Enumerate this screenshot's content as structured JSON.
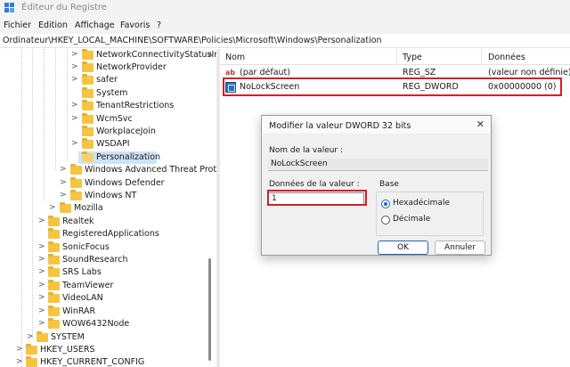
{
  "window": {
    "title": "Éditeur du Registre"
  },
  "menu": [
    "Fichier",
    "Edition",
    "Affichage",
    "Favoris",
    "?"
  ],
  "address": "Ordinateur\\HKEY_LOCAL_MACHINE\\SOFTWARE\\Policies\\Microsoft\\Windows\\Personalization",
  "tree": [
    {
      "label": "NetworkConnectivityStatusIr",
      "chev": ">"
    },
    {
      "label": "NetworkProvider",
      "chev": ">"
    },
    {
      "label": "safer",
      "chev": ">"
    },
    {
      "label": "System",
      "chev": ""
    },
    {
      "label": "TenantRestrictions",
      "chev": ">"
    },
    {
      "label": "WcmSvc",
      "chev": ">"
    },
    {
      "label": "WorkplaceJoin",
      "chev": ""
    },
    {
      "label": "WSDAPI",
      "chev": ">"
    },
    {
      "label": "Personalization",
      "chev": ""
    },
    {
      "label": "Windows Advanced Threat Prote",
      "chev": ">"
    },
    {
      "label": "Windows Defender",
      "chev": ">"
    },
    {
      "label": "Windows NT",
      "chev": ">"
    },
    {
      "label": "Mozilla",
      "chev": ">"
    },
    {
      "label": "Realtek",
      "chev": ">"
    },
    {
      "label": "RegisteredApplications",
      "chev": ""
    },
    {
      "label": "SonicFocus",
      "chev": ">"
    },
    {
      "label": "SoundResearch",
      "chev": ">"
    },
    {
      "label": "SRS Labs",
      "chev": ">"
    },
    {
      "label": "TeamViewer",
      "chev": ">"
    },
    {
      "label": "VideoLAN",
      "chev": ">"
    },
    {
      "label": "WinRAR",
      "chev": ">"
    },
    {
      "label": "WOW6432Node",
      "chev": ">"
    },
    {
      "label": "SYSTEM",
      "chev": ">"
    },
    {
      "label": "HKEY_USERS",
      "chev": ">"
    },
    {
      "label": "HKEY_CURRENT_CONFIG",
      "chev": ">"
    }
  ],
  "list": {
    "columns": {
      "name": "Nom",
      "type": "Type",
      "data": "Données"
    },
    "rows": [
      {
        "name": "(par défaut)",
        "type": "REG_SZ",
        "data": "(valeur non définie)",
        "icon": "string-value-icon"
      },
      {
        "name": "NoLockScreen",
        "type": "REG_DWORD",
        "data": "0x00000000 (0)",
        "icon": "dword-value-icon"
      }
    ]
  },
  "dialog": {
    "title": "Modifier la valeur DWORD 32 bits",
    "close": "✕",
    "name_label": "Nom de la valeur :",
    "name_value": "NoLockScreen",
    "data_label": "Données de la valeur :",
    "data_value": "1",
    "base_label": "Base",
    "radio_hex": "Hexadécimale",
    "radio_dec": "Décimale",
    "selected_base": "hex",
    "ok": "OK",
    "cancel": "Annuler"
  },
  "colors": {
    "highlight": "#d0202a",
    "accent": "#1f64c8",
    "selection": "#cde3f7"
  }
}
